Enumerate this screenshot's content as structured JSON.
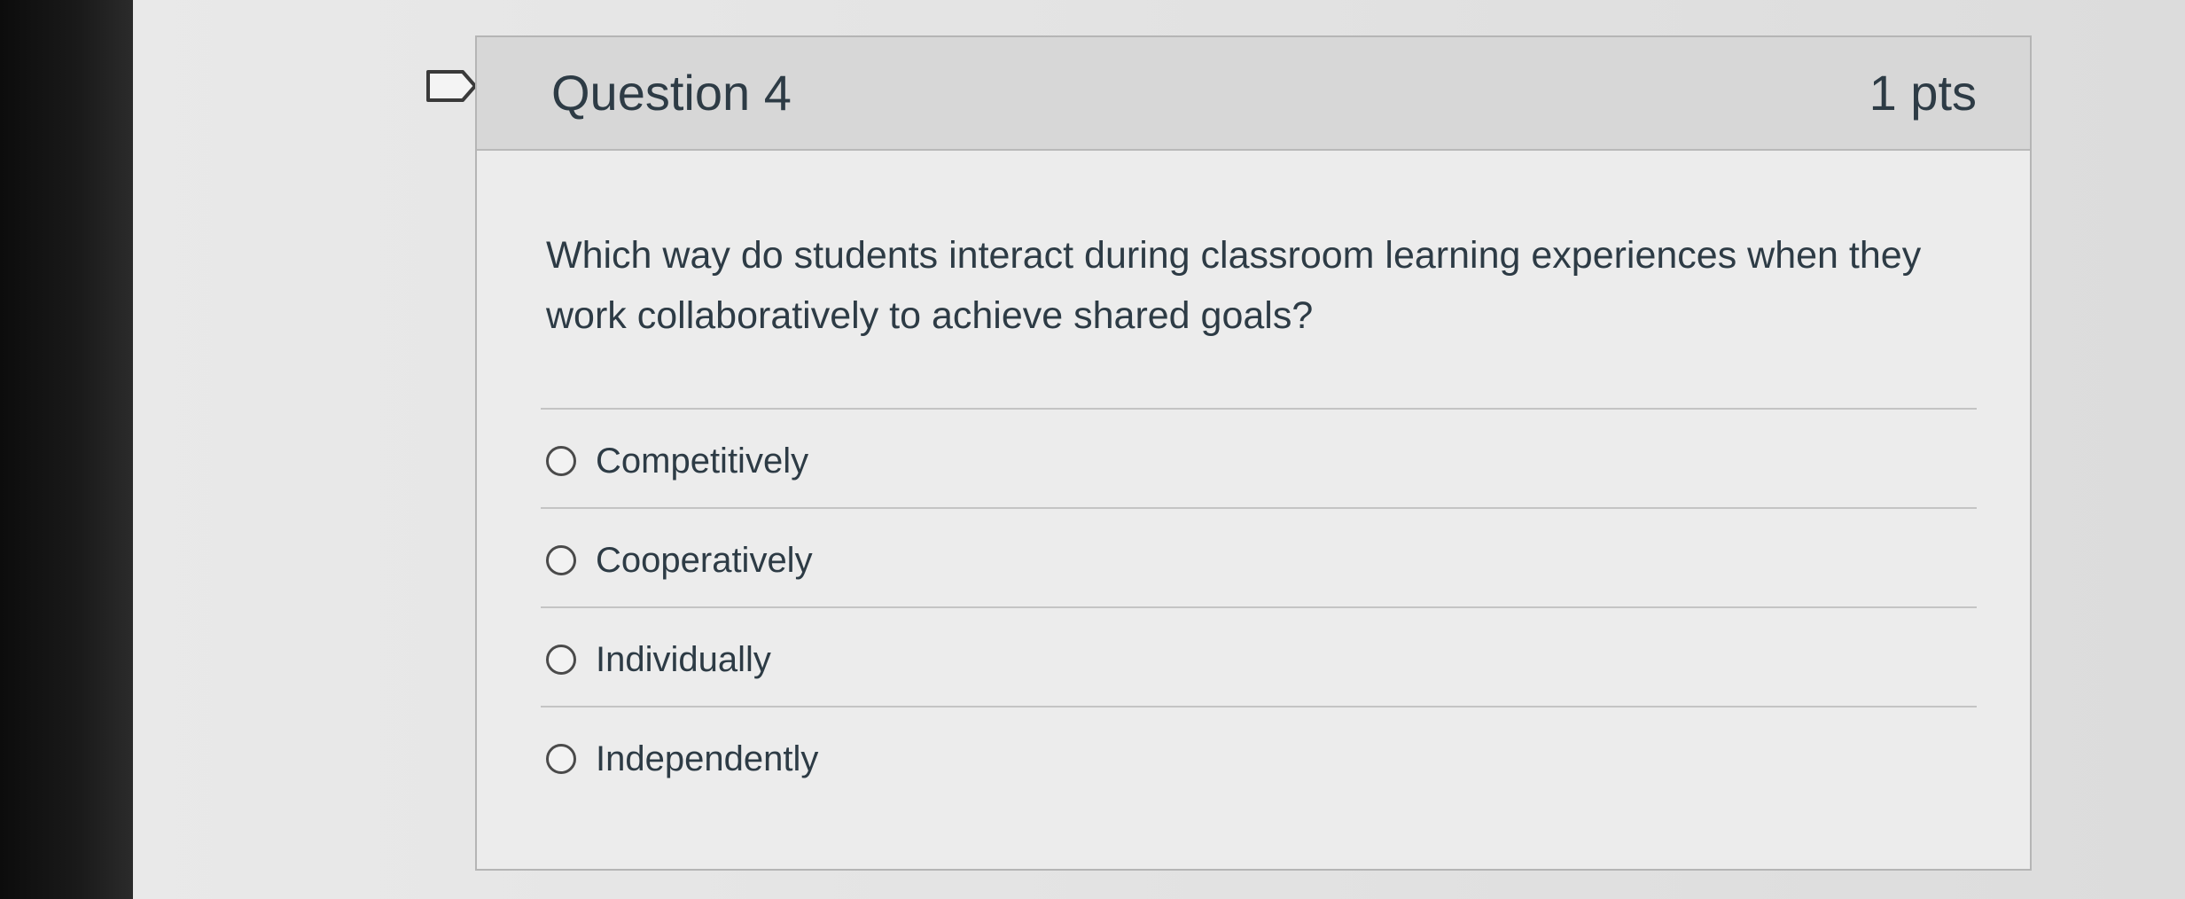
{
  "question": {
    "title": "Question 4",
    "points": "1 pts",
    "text": "Which way do students interact during classroom learning experiences when they work collaboratively to achieve shared goals?",
    "answers": [
      {
        "label": "Competitively",
        "selected": false
      },
      {
        "label": "Cooperatively",
        "selected": false
      },
      {
        "label": "Individually",
        "selected": false
      },
      {
        "label": "Independently",
        "selected": false
      }
    ]
  },
  "icons": {
    "flag": "flag-question-icon",
    "radio": "radio-button-icon"
  },
  "colors": {
    "text": "#2d3b45",
    "header_bg": "#d7d7d7",
    "border": "#b5b5b5"
  }
}
